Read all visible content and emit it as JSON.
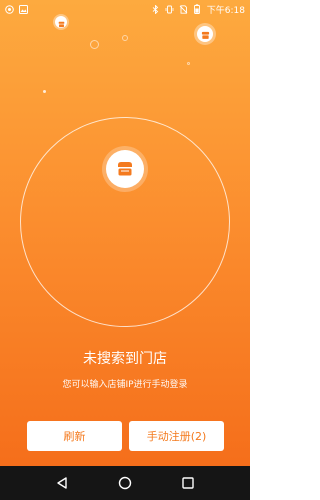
{
  "status_bar": {
    "time_label": "下午6:18",
    "icons": [
      "app-icon",
      "image-icon",
      "bluetooth-icon",
      "vibrate-icon",
      "no-sim-icon",
      "battery-icon"
    ]
  },
  "main": {
    "title": "未搜索到门店",
    "subtitle": "您可以输入店铺IP进行手动登录"
  },
  "buttons": {
    "refresh_label": "刷新",
    "manual_label": "手动注册(2)"
  },
  "nav_bar": {
    "icons": [
      "back-icon",
      "home-icon",
      "recents-icon"
    ]
  },
  "colors": {
    "gradient_top": "#fdaa3f",
    "gradient_bottom": "#f46a18",
    "button_text": "#f47a1e",
    "nav_bar": "#151515"
  }
}
